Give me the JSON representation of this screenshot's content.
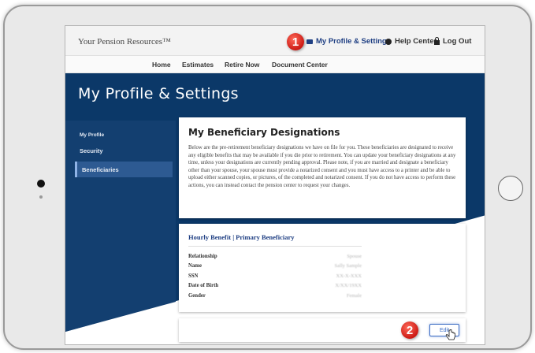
{
  "header": {
    "brand": "Your Pension Resources™",
    "profile_link": "My Profile & Settings",
    "help_link": "Help Center",
    "logout_link": "Log Out"
  },
  "nav": {
    "items": [
      "Home",
      "Estimates",
      "Retire Now",
      "Document Center"
    ]
  },
  "page": {
    "title": "My Profile & Settings"
  },
  "sidebar": {
    "items": [
      {
        "label": "My Profile",
        "active": false
      },
      {
        "label": "Security",
        "active": false
      },
      {
        "label": "Beneficiaries",
        "active": true
      }
    ]
  },
  "designations": {
    "title": "My Beneficiary Designations",
    "body": "Below are the pre-retirement beneficiary designations we have on file for you. These beneficiaries are designated to receive any eligible benefits that may be available if you die prior to retirement. You can update your beneficiary designations at any time, unless your designations are currently pending approval. Please note, if you are married and designate a beneficiary other than your spouse, your spouse must provide a notarized consent and you must have access to a printer and be able to upload either scanned copies, or pictures, of the completed and notarized consent. If you do not have access to perform these actions, you can instead contact the pension center to request your changes."
  },
  "beneficiary": {
    "title": "Hourly Benefit | Primary Beneficiary",
    "rows": [
      {
        "label": "Relationship",
        "value": "Spouse"
      },
      {
        "label": "Name",
        "value": "Sally Sample"
      },
      {
        "label": "SSN",
        "value": "XX-X-XXX"
      },
      {
        "label": "Date of Birth",
        "value": "X/XX/19XX"
      },
      {
        "label": "Gender",
        "value": "Female"
      }
    ]
  },
  "actions": {
    "edit_label": "Edit"
  },
  "callouts": [
    "1",
    "2"
  ],
  "colors": {
    "hero": "#0b3868",
    "accent": "#1f3f83",
    "callout": "#d9241c",
    "sidebar_active": "#2d5a92"
  },
  "icons": {
    "profile": "document-icon",
    "help": "info-icon",
    "logout": "lock-icon",
    "cursor": "hand-pointer-icon"
  }
}
